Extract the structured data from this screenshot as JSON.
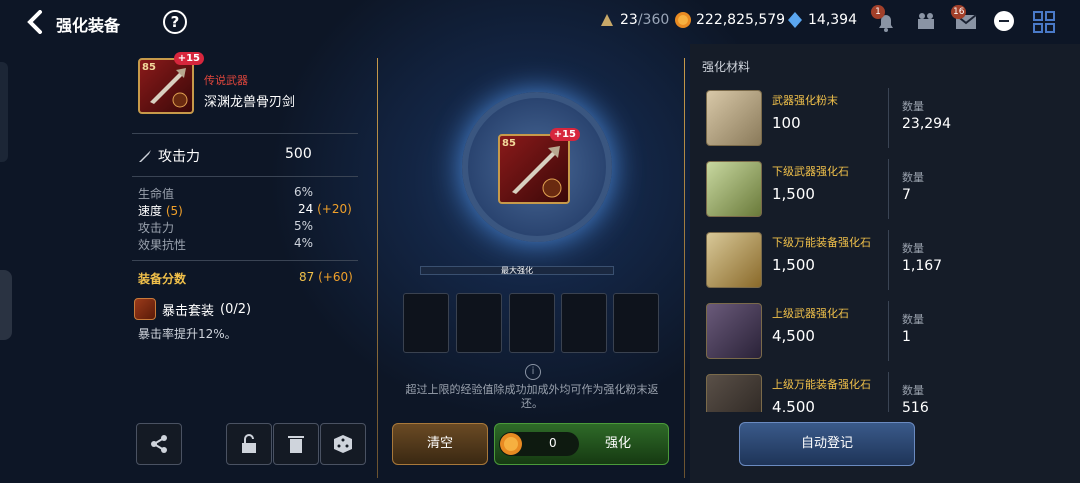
{
  "header": {
    "title": "强化装备",
    "help": "?",
    "stamina": "23",
    "stamina_max": "/360",
    "gold": "222,825,579",
    "gems": "14,394",
    "badge_bell": "1",
    "badge_mail": "16"
  },
  "item": {
    "level": "85",
    "plus": "+15",
    "rarity": "传说武器",
    "name": "深渊龙兽骨刃剑",
    "attack_label": "攻击力",
    "attack_value": "500",
    "stats": [
      {
        "label": "生命值",
        "value": "6%"
      },
      {
        "label": "速度",
        "label_extra": "(5)",
        "value": "24",
        "bonus": "(+20)"
      },
      {
        "label": "攻击力",
        "value": "5%"
      },
      {
        "label": "效果抗性",
        "value": "4%"
      }
    ],
    "score_label": "装备分数",
    "score_value": "87",
    "score_bonus": "(+60)",
    "set_label": "暴击套装",
    "set_count": "(0/2)",
    "set_desc": "暴击率提升12%。"
  },
  "center": {
    "max_label": "最大强化",
    "note": "超过上限的经验值除成功加成外均可作为强化粉末返还。",
    "clear_label": "清空",
    "cost": "0",
    "enhance_label": "强化"
  },
  "materials": {
    "title": "强化材料",
    "qty_label": "数量",
    "auto_label": "自动登记",
    "items": [
      {
        "name": "武器强化粉末",
        "cost": "100",
        "qty": "23,294"
      },
      {
        "name": "下级武器强化石",
        "cost": "1,500",
        "qty": "7"
      },
      {
        "name": "下级万能装备强化石",
        "cost": "1,500",
        "qty": "1,167"
      },
      {
        "name": "上级武器强化石",
        "cost": "4,500",
        "qty": "1"
      },
      {
        "name": "上级万能装备强化石",
        "cost": "4,500",
        "qty": "516"
      }
    ]
  },
  "colors": {
    "gold": "#f0c04a",
    "bonus": "#f0a02a",
    "rarity": "#e0463c",
    "accent": "#c79a4a"
  }
}
